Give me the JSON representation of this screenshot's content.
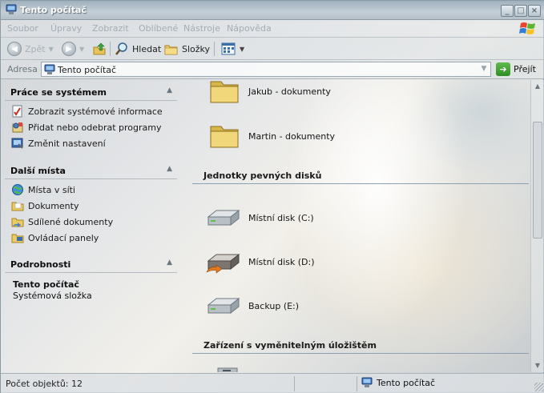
{
  "window": {
    "title": "Tento počítač",
    "controls": {
      "minimize": "_",
      "maximize": "□",
      "close": "×"
    }
  },
  "menubar": {
    "items": [
      "Soubor",
      "Úpravy",
      "Zobrazit",
      "Oblíbené",
      "Nástroje",
      "Nápověda"
    ]
  },
  "toolbar": {
    "back_label": "Zpět",
    "search_label": "Hledat",
    "folders_label": "Složky"
  },
  "address": {
    "label": "Adresa",
    "value": "Tento počítač",
    "go_label": "Přejít"
  },
  "taskpane": {
    "system": {
      "title": "Práce se systémem",
      "items": [
        {
          "label": "Zobrazit systémové informace",
          "icon": "system-info-icon"
        },
        {
          "label": "Přidat nebo odebrat programy",
          "icon": "add-remove-programs-icon"
        },
        {
          "label": "Změnit nastavení",
          "icon": "control-panel-settings-icon"
        }
      ]
    },
    "places": {
      "title": "Další místa",
      "items": [
        {
          "label": "Místa v síti",
          "icon": "network-places-icon"
        },
        {
          "label": "Dokumenty",
          "icon": "documents-folder-icon"
        },
        {
          "label": "Sdílené dokumenty",
          "icon": "shared-folder-icon"
        },
        {
          "label": "Ovládací panely",
          "icon": "control-panel-icon"
        }
      ]
    },
    "details": {
      "title": "Podrobnosti",
      "name": "Tento počítač",
      "type": "Systémová složka"
    }
  },
  "content": {
    "folders": [
      {
        "label": "Jakub - dokumenty"
      },
      {
        "label": "Martin - dokumenty"
      }
    ],
    "hard_drives_header": "Jednotky pevných disků",
    "drives": [
      {
        "label": "Místní disk (C:)",
        "icon": "hard-drive-icon"
      },
      {
        "label": "Místní disk (D:)",
        "icon": "shared-hard-drive-icon"
      },
      {
        "label": "Backup (E:)",
        "icon": "hard-drive-icon"
      }
    ],
    "removable_header": "Zařízení s vyměnitelným úložištěm"
  },
  "statusbar": {
    "count_text": "Počet objektů: 12",
    "location_text": "Tento počítač"
  }
}
